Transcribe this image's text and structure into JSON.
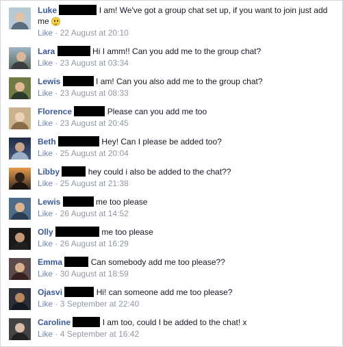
{
  "like_label": "Like",
  "separator": "·",
  "comments": [
    {
      "author": "Luke",
      "text_line1": "I am! We've got a group chat set up, if you want to join just add",
      "text_line2": "me",
      "emoji": "smile-icon",
      "time": "22 August at 20:10"
    },
    {
      "author": "Lara",
      "text": "Hi I amm!! Can you add me to the group chat?",
      "time": "23 August at 03:34"
    },
    {
      "author": "Lewis",
      "text": "I am! Can you also add me to the group chat?",
      "time": "23 August at 08:33"
    },
    {
      "author": "Florence",
      "text": "Please can you add me too",
      "time": "23 August at 20:45"
    },
    {
      "author": "Beth",
      "text": "Hey! Can I please be added too?",
      "time": "25 August at 20:04"
    },
    {
      "author": "Libby",
      "text": "hey could i also be added to the chat??",
      "time": "25 August at 21:38"
    },
    {
      "author": "Lewis",
      "text": "me too please",
      "time": "26 August at 14:52"
    },
    {
      "author": "Olly",
      "text": "me too please",
      "time": "26 August at 16:29"
    },
    {
      "author": "Emma",
      "text": "Can somebody add me too please??",
      "time": "30 August at 18:59"
    },
    {
      "author": "Ojasvi",
      "text": "Hi! can someone add me too please?",
      "time": "3 September at 22:40"
    },
    {
      "author": "Caroline",
      "text": "I am too, could I be added to the chat! x",
      "time": "4 September at 16:42"
    }
  ],
  "colors": {
    "author": "#3b5998",
    "like": "#6d84b4",
    "meta": "#9197a3",
    "redaction": "#000000"
  }
}
